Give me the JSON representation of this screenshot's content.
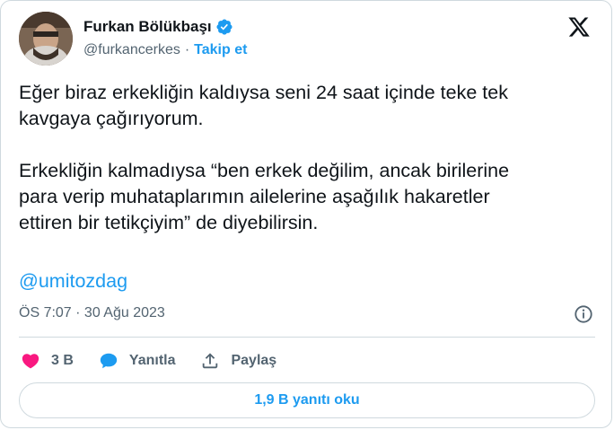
{
  "author": {
    "display_name": "Furkan Bölükbaşı",
    "handle": "@furkancerkes",
    "separator": "·",
    "follow_label": "Takip et",
    "verified": true
  },
  "tweet": {
    "text": "Eğer biraz erkekliğin kaldıysa seni 24 saat içinde teke tek\nkavgaya çağırıyorum.\n\nErkekliğin kalmadıysa “ben erkek değilim, ancak birilerine\npara verip muhataplarımın ailelerine aşağılık hakaretler\nettiren bir tetikçiyim” de diyebilirsin.",
    "mention": "@umitozdag",
    "timestamp": "ÖS 7:07 · 30 Ağu 2023"
  },
  "actions": {
    "like_count": "3 B",
    "reply_label": "Yanıtla",
    "share_label": "Paylaş"
  },
  "replies_button": "1,9 B yanıtı oku",
  "colors": {
    "accent": "#1d9bf0",
    "like": "#f91880",
    "text": "#0f1419",
    "secondary": "#536471",
    "border": "#cfd9de"
  }
}
